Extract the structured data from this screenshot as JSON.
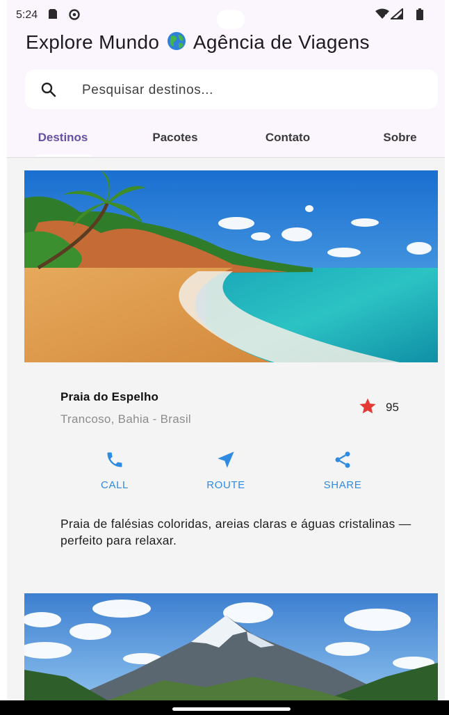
{
  "status_bar": {
    "time": "5:24",
    "icons": [
      "sd-card-icon",
      "sync-icon",
      "wifi-icon",
      "signal-icon",
      "battery-icon"
    ]
  },
  "app": {
    "title_before": "Explore Mundo",
    "title_icon": "globe-icon",
    "title_after": "Agência de Viagens"
  },
  "search": {
    "placeholder": "Pesquisar destinos...",
    "value": "",
    "icon": "search-icon"
  },
  "tabs": [
    {
      "label": "Destinos",
      "active": true
    },
    {
      "label": "Pacotes",
      "active": false
    },
    {
      "label": "Contato",
      "active": false
    },
    {
      "label": "Sobre",
      "active": false
    }
  ],
  "destinations": [
    {
      "title": "Praia do Espelho",
      "location": "Trancoso, Bahia - Brasil",
      "rating": "95",
      "rating_icon": "star-icon",
      "description": "Praia de falésias coloridas, areias claras e águas cristalinas — perfeito para relaxar.",
      "image": "beach-photo",
      "actions": [
        {
          "label": "CALL",
          "icon": "phone-icon"
        },
        {
          "label": "ROUTE",
          "icon": "navigation-icon"
        },
        {
          "label": "SHARE",
          "icon": "share-icon"
        }
      ]
    },
    {
      "image": "mountain-photo"
    }
  ],
  "colors": {
    "accent": "#6750a4",
    "action_blue": "#2f8ae2",
    "star_red": "#e53935",
    "app_bar_bg": "#fbf5fd",
    "page_bg": "#f4f4f4"
  }
}
